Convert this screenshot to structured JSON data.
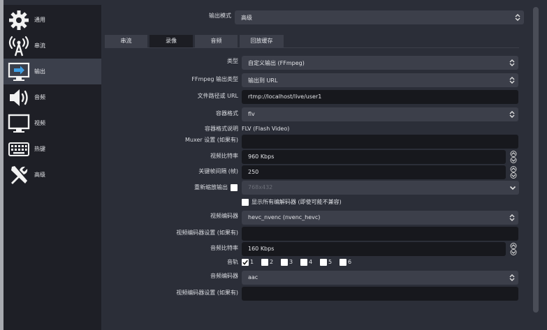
{
  "sidebar": {
    "items": [
      {
        "label": "通用",
        "icon": "gear-icon"
      },
      {
        "label": "串流",
        "icon": "broadcast-antenna-icon"
      },
      {
        "label": "输出",
        "icon": "output-monitor-icon"
      },
      {
        "label": "音频",
        "icon": "speaker-icon"
      },
      {
        "label": "视频",
        "icon": "monitor-icon"
      },
      {
        "label": "热键",
        "icon": "keyboard-icon"
      },
      {
        "label": "高级",
        "icon": "tools-icon"
      }
    ],
    "active_index": 2
  },
  "output_mode": {
    "label": "输出模式",
    "value": "高级"
  },
  "tabs": [
    {
      "label": "串流"
    },
    {
      "label": "录像"
    },
    {
      "label": "音频"
    },
    {
      "label": "回放缓存"
    }
  ],
  "active_tab_index": 1,
  "form": {
    "type": {
      "label": "类型",
      "value": "自定义输出 (FFmpeg)"
    },
    "ffmpeg_output_type": {
      "label": "FFmpeg 输出类型",
      "value": "输出到 URL"
    },
    "file_path_or_url": {
      "label": "文件路径或 URL",
      "value": "rtmp://localhost/live/user1"
    },
    "container_format": {
      "label": "容器格式",
      "value": "flv"
    },
    "container_format_desc": {
      "label": "容器格式说明",
      "value": "FLV (Flash Video)"
    },
    "muxer_settings": {
      "label": "Muxer 设置 (如果有)",
      "value": ""
    },
    "video_bitrate": {
      "label": "视频比特率",
      "value": "960 Kbps"
    },
    "keyframe_interval": {
      "label": "关键帧间隔 (帧)",
      "value": "250"
    },
    "rescale_output": {
      "label": "重新缩放输出",
      "value": "768x432",
      "checked": false
    },
    "show_all_codecs": {
      "label": "显示所有编解码器 (即使可能不兼容)",
      "checked": false
    },
    "video_encoder": {
      "label": "视频编码器",
      "value": "hevc_nvenc (nvenc_hevc)"
    },
    "video_encoder_settings": {
      "label": "视频编码器设置 (如果有)",
      "value": ""
    },
    "audio_bitrate": {
      "label": "音频比特率",
      "value": "160 Kbps"
    },
    "audio_tracks": {
      "label": "音轨",
      "tracks": [
        {
          "label": "1",
          "checked": true
        },
        {
          "label": "2",
          "checked": false
        },
        {
          "label": "3",
          "checked": false
        },
        {
          "label": "4",
          "checked": false
        },
        {
          "label": "5",
          "checked": false
        },
        {
          "label": "6",
          "checked": false
        }
      ]
    },
    "audio_encoder": {
      "label": "音频编码器",
      "value": "aac"
    },
    "audio_encoder_settings": {
      "label": "视频编码器设置 (如果有)",
      "value": ""
    }
  },
  "colors": {
    "sidebar_bg": "#1e1f26",
    "panel_bg": "#2b2e38",
    "field_bg": "#3c3f4a",
    "text_field_bg": "#17181d",
    "active_item_bg": "#3b3f4b"
  }
}
